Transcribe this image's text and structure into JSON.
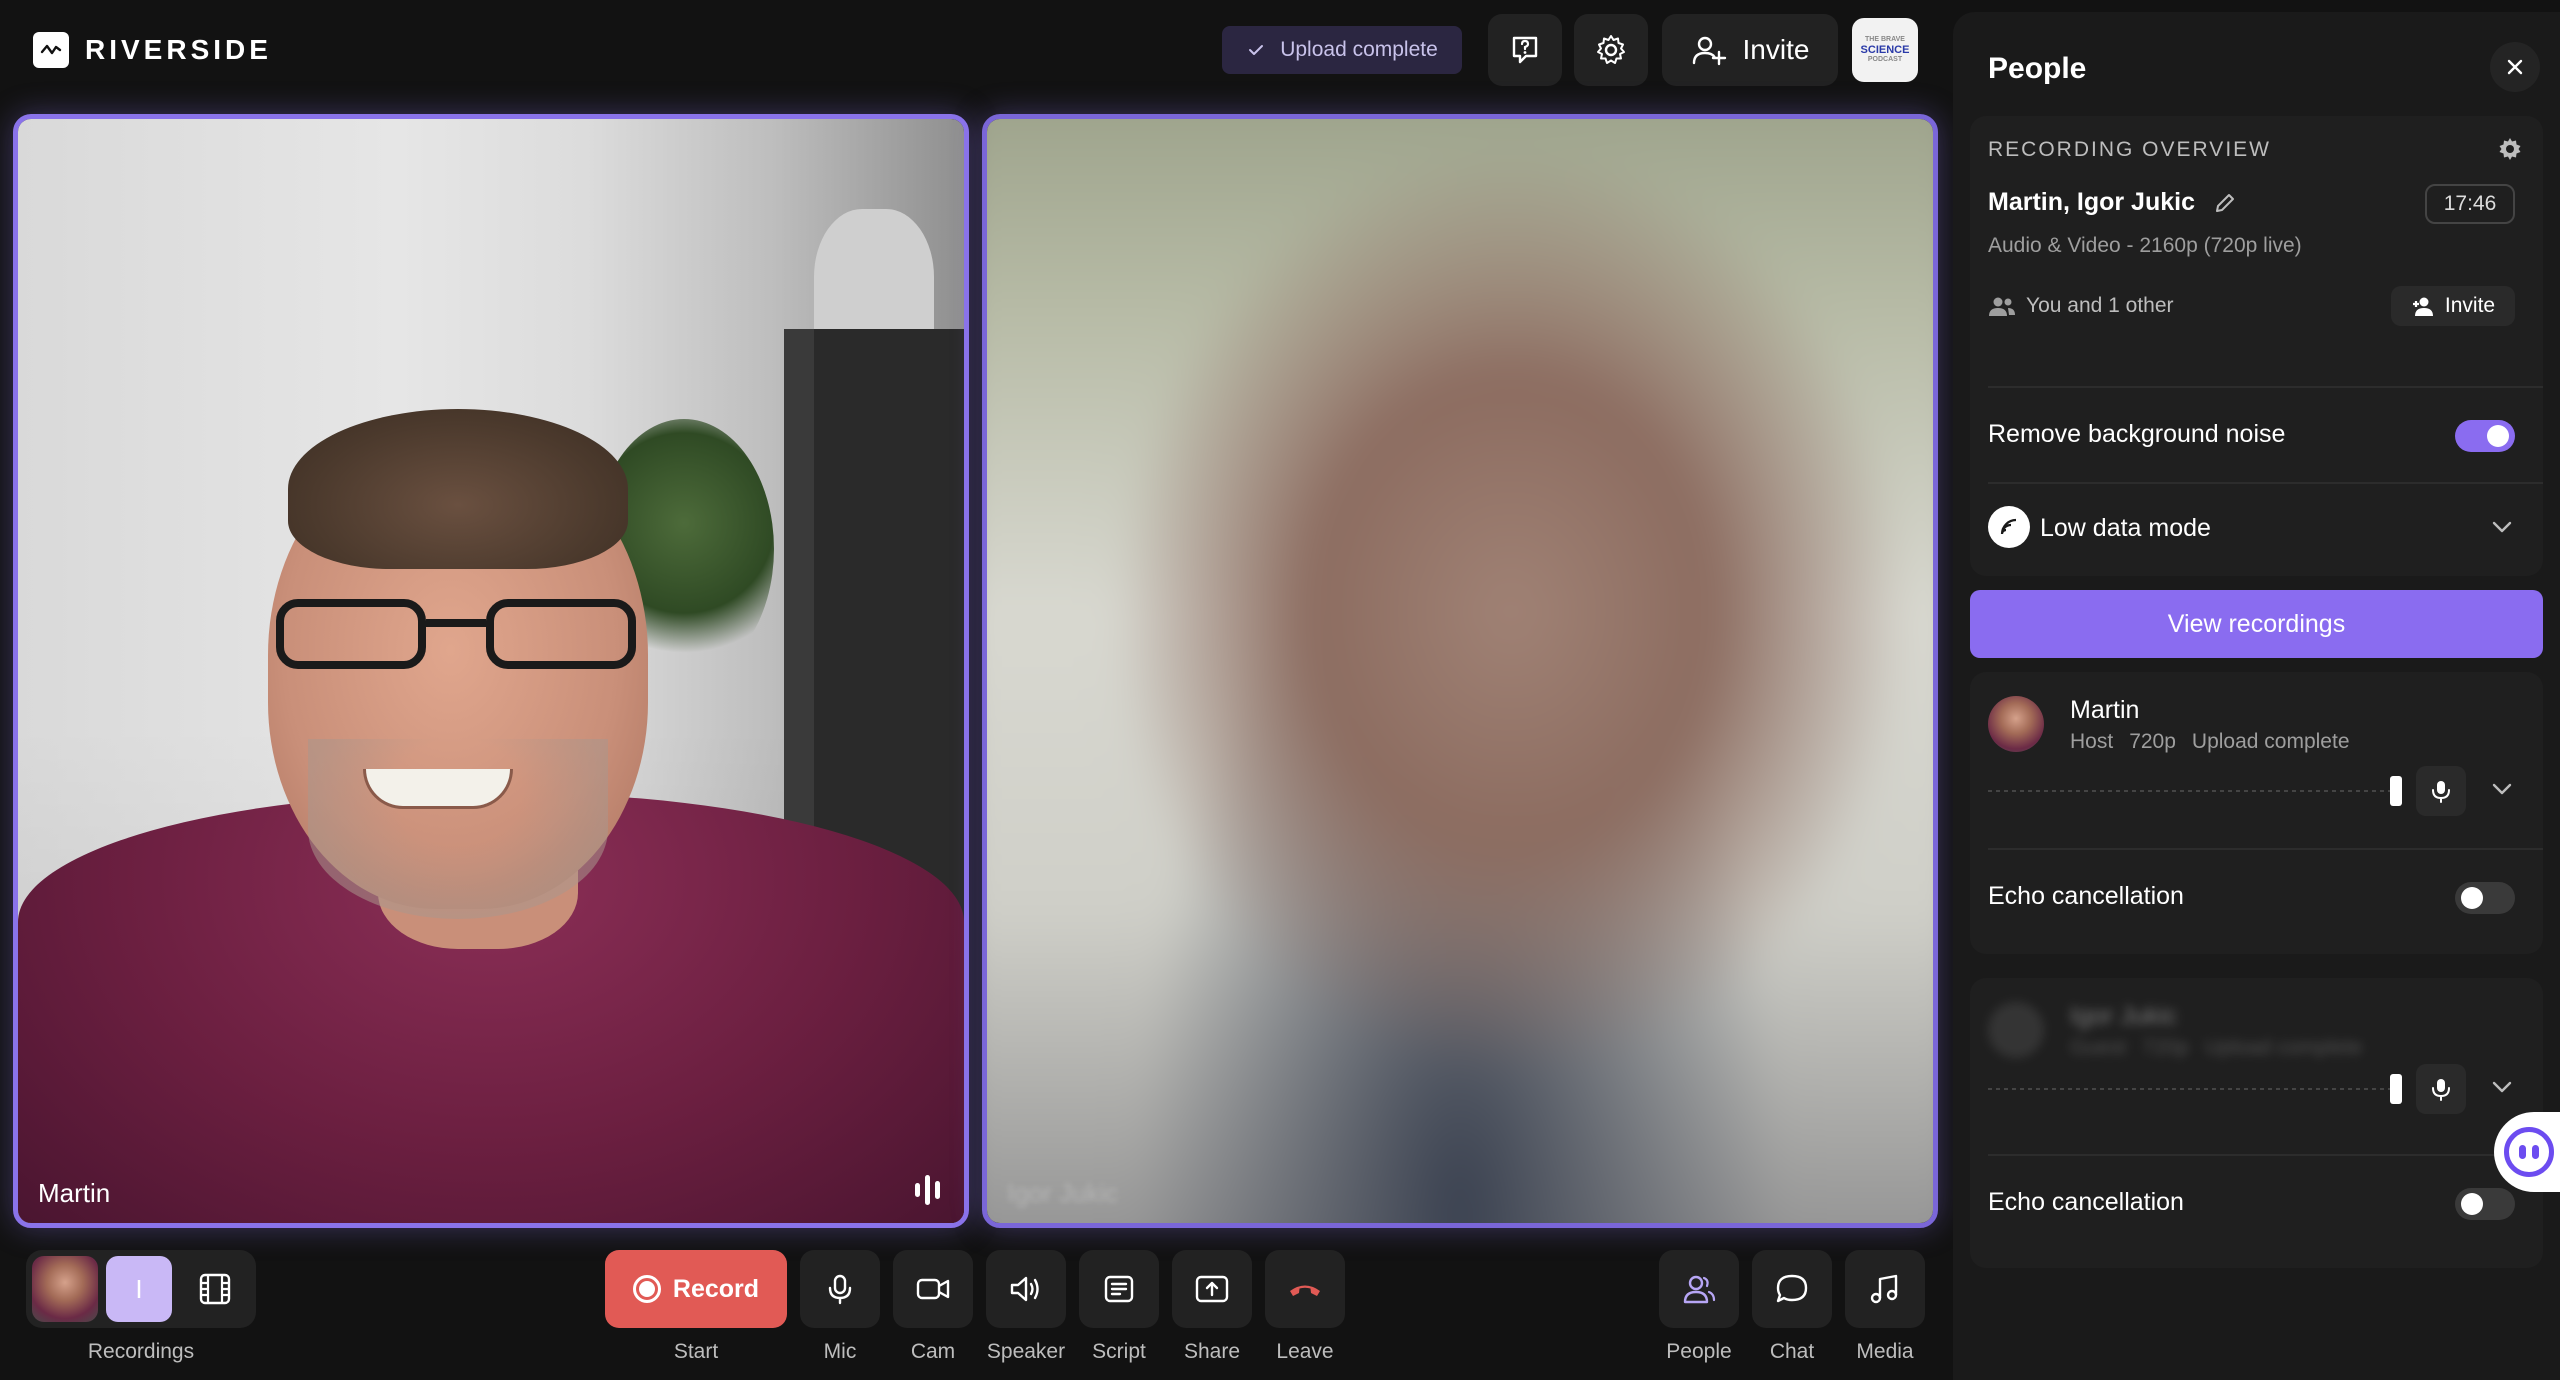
{
  "app": {
    "brand": "RIVERSIDE"
  },
  "header": {
    "upload_status": "Upload complete",
    "invite_label": "Invite",
    "badge_line1": "THE BRAVE",
    "badge_line2": "SCIENCE",
    "badge_line3": "PODCAST"
  },
  "tiles": {
    "left_name": "Martin",
    "right_name": "Igor Jukic"
  },
  "bottom": {
    "recordings_letter": "I",
    "recordings_label": "Recordings",
    "record_label": "Record",
    "start_label": "Start",
    "mic_label": "Mic",
    "cam_label": "Cam",
    "speaker_label": "Speaker",
    "script_label": "Script",
    "share_label": "Share",
    "leave_label": "Leave",
    "people_label": "People",
    "chat_label": "Chat",
    "media_label": "Media"
  },
  "panel": {
    "title": "People",
    "overview": {
      "label": "RECORDING OVERVIEW",
      "names": "Martin, Igor Jukic",
      "timer": "17:46",
      "meta": "Audio & Video - 2160p (720p live)",
      "people": "You and 1 other",
      "invite": "Invite"
    },
    "remove_noise_label": "Remove background noise",
    "remove_noise_on": true,
    "low_data_label": "Low data mode",
    "view_recordings": "View recordings",
    "participants": [
      {
        "name": "Martin",
        "role": "Host",
        "quality": "720p",
        "status": "Upload complete",
        "echo_label": "Echo cancellation",
        "echo_on": false,
        "mic_level": 0.96
      },
      {
        "name": "Igor Jukic",
        "role": "Guest",
        "quality": "720p",
        "status": "Upload complete",
        "echo_label": "Echo cancellation",
        "echo_on": false,
        "mic_level": 0.96
      }
    ]
  },
  "colors": {
    "accent": "#8a6cf0",
    "record": "#e15a55",
    "panel_bg": "#1a1a1a",
    "app_bg": "#121212"
  }
}
